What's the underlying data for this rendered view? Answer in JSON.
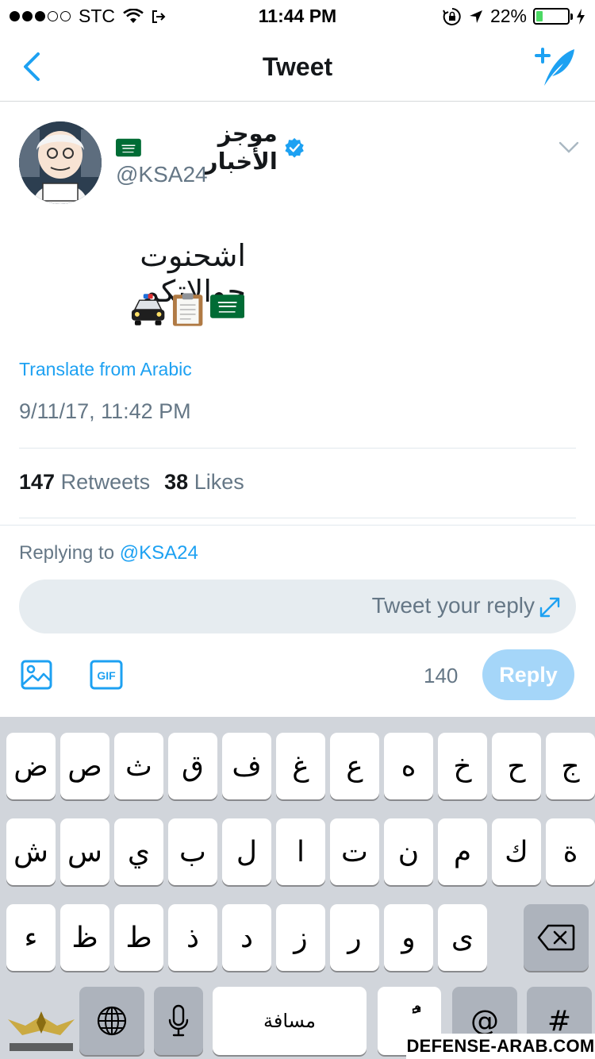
{
  "status_bar": {
    "signal_filled": 3,
    "signal_total": 5,
    "carrier": "STC",
    "time": "11:44 PM",
    "battery_text": "22%",
    "battery_level": 0.22
  },
  "nav": {
    "title": "Tweet"
  },
  "tweet": {
    "author_name": "موجز الأخبار",
    "handle": "@KSA24",
    "text": "اشحنوت جوالاتكم",
    "emoji": [
      "police-car",
      "clipboard",
      "saudi-flag"
    ],
    "translate_label": "Translate from Arabic",
    "timestamp": "9/11/17, 11:42 PM",
    "retweets_count": "147",
    "retweets_label": "Retweets",
    "likes_count": "38",
    "likes_label": "Likes"
  },
  "reply": {
    "replying_prefix": "Replying to",
    "replying_handle": "@KSA24",
    "placeholder": "Tweet your reply",
    "char_count": "140",
    "reply_button": "Reply"
  },
  "keyboard": {
    "row1": [
      "ج",
      "ح",
      "خ",
      "ه",
      "ع",
      "غ",
      "ف",
      "ق",
      "ث",
      "ص",
      "ض"
    ],
    "row2": [
      "ة",
      "ك",
      "م",
      "ن",
      "ت",
      "ا",
      "ل",
      "ب",
      "ي",
      "س",
      "ش"
    ],
    "row3": [
      "ى",
      "و",
      "ر",
      "ز",
      "د",
      "ذ",
      "ط",
      "ظ",
      "ء"
    ],
    "space_label": "مسافة",
    "diacritic_label": "ًٌ",
    "at_label": "@",
    "hash_label": "#"
  },
  "watermark": {
    "site": "DEFENSE-ARAB.COM"
  },
  "colors": {
    "twitter_blue": "#1da1f2",
    "verified_blue": "#1da1f2",
    "reply_disabled": "#a5d6f9",
    "battery_green": "#4cd964",
    "keyboard_bg": "#d1d5db"
  }
}
